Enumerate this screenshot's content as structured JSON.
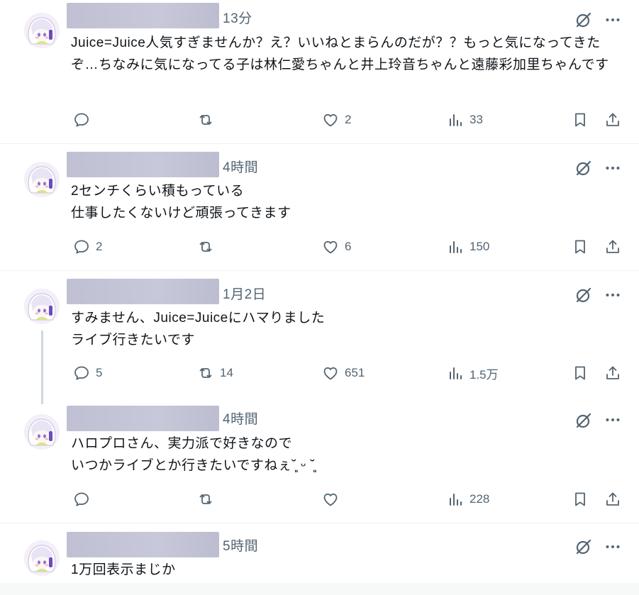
{
  "posts": [
    {
      "time": "13分",
      "text": "Juice=Juice人気すぎませんか？え？いいねとまらんのだが？？もっと気になってきたぞ…ちなみに気になってる子は林仁愛ちゃんと井上玲音ちゃんと遠藤彩加里ちゃんです",
      "replies": "",
      "reposts": "",
      "likes": "2",
      "views": "33"
    },
    {
      "time": "4時間",
      "text": "2センチくらい積もっている\n仕事したくないけど頑張ってきます",
      "replies": "2",
      "reposts": "",
      "likes": "6",
      "views": "150"
    },
    {
      "time": "1月2日",
      "text": "すみません、Juice=Juiceにハマりました\nライブ行きたいです",
      "replies": "5",
      "reposts": "14",
      "likes": "651",
      "views": "1.5万"
    },
    {
      "time": "4時間",
      "text": "ハロプロさん、実力派で好きなので\nいつかライブとか行きたいですねぇ˘͈ ᵕ ˘͈",
      "replies": "",
      "reposts": "",
      "likes": "",
      "views": "228"
    },
    {
      "time": "5時間",
      "text": "1万回表示まじか",
      "replies": "",
      "reposts": "",
      "likes": "",
      "views": ""
    }
  ],
  "icons": {
    "reply": "reply-icon",
    "repost": "repost-icon",
    "like": "heart-icon",
    "views": "views-chart-icon",
    "bookmark": "bookmark-icon",
    "share": "share-icon",
    "grok": "grok-icon",
    "more": "more-dots-icon"
  },
  "colors": {
    "icon_gray": "#536471",
    "text": "#0f1419",
    "separator": "#eff3f4",
    "thread_line": "#cfd9de",
    "name_redaction": "#c4c5d6"
  }
}
